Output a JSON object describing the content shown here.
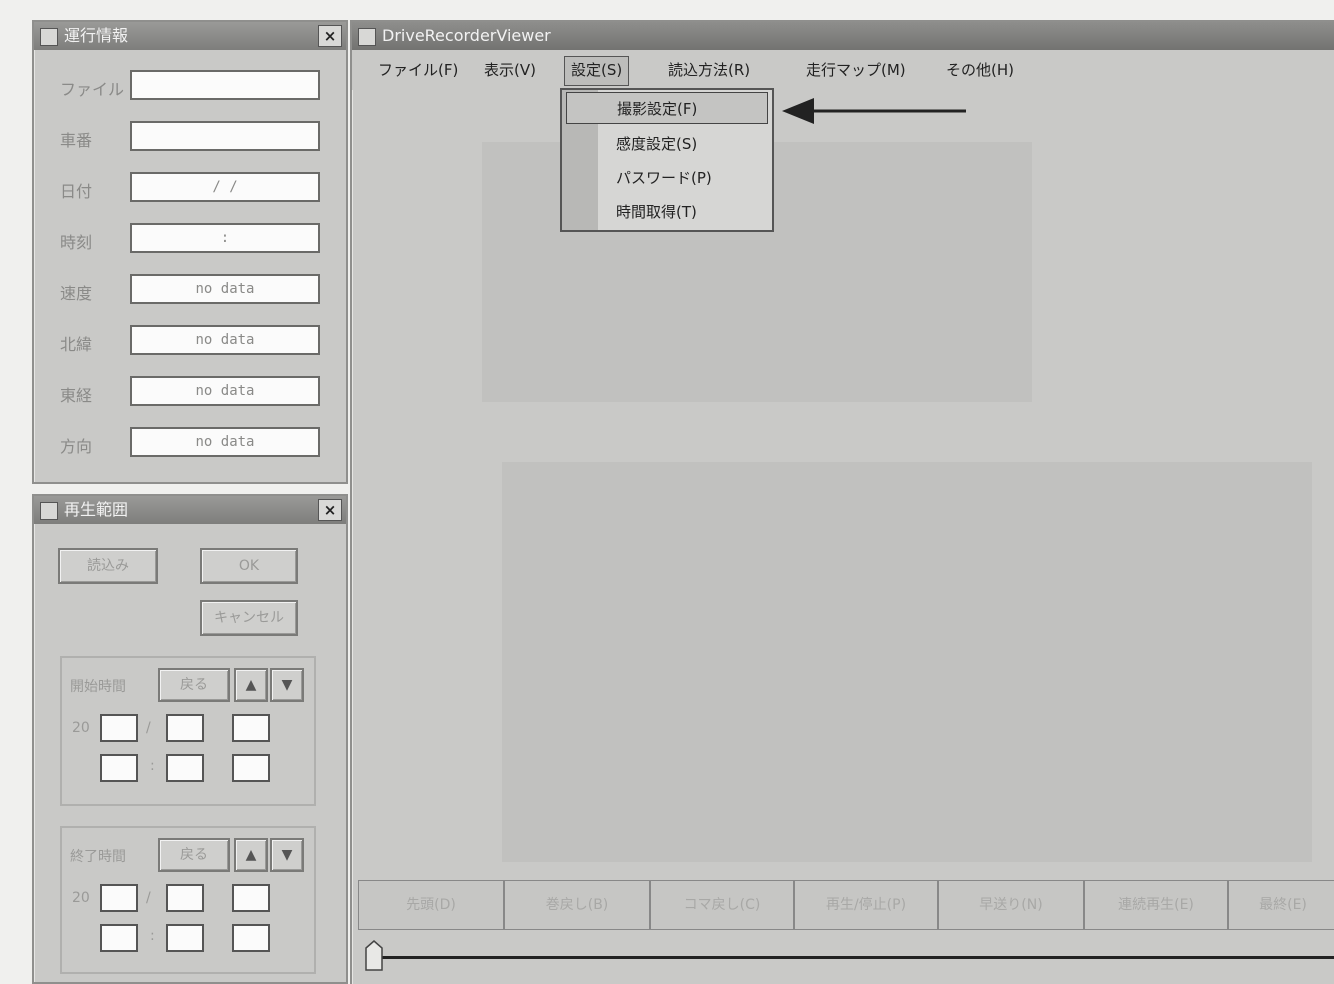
{
  "info_window": {
    "title": "運行情報",
    "close": "×",
    "rows": [
      {
        "label": "ファイル",
        "value": ""
      },
      {
        "label": "車番",
        "value": ""
      },
      {
        "label": "日付",
        "value": "/ /"
      },
      {
        "label": "時刻",
        "value": ":"
      },
      {
        "label": "速度",
        "value": "no data"
      },
      {
        "label": "北緯",
        "value": "no data"
      },
      {
        "label": "東経",
        "value": "no data"
      },
      {
        "label": "方向",
        "value": "no data"
      }
    ]
  },
  "playback_window": {
    "title": "再生範囲",
    "close": "×",
    "buttons": {
      "read": "読込み",
      "ok": "OK",
      "cancel": "キャンセル"
    },
    "start": {
      "label": "開始時間",
      "button": "戻る",
      "up": "▲",
      "down": "▼",
      "prefix": "20",
      "sep1": "/",
      "sep2": ":"
    },
    "end": {
      "label": "終了時間",
      "button": "戻る",
      "up": "▲",
      "down": "▼",
      "prefix": "20",
      "sep1": "/",
      "sep2": ":"
    }
  },
  "main_window": {
    "title": "DriveRecorderViewer",
    "menu": [
      {
        "label": "ファイル(F)"
      },
      {
        "label": "表示(V)"
      },
      {
        "label": "設定(S)"
      },
      {
        "label": "読込方法(R)"
      },
      {
        "label": "走行マップ(M)"
      },
      {
        "label": "その他(H)"
      }
    ],
    "dropdown": [
      {
        "label": "撮影設定(F)"
      },
      {
        "label": "感度設定(S)"
      },
      {
        "label": "パスワード(P)"
      },
      {
        "label": "時間取得(T)"
      }
    ],
    "toolbar": [
      {
        "label": "先頭(D)"
      },
      {
        "label": "巻戻し(B)"
      },
      {
        "label": "コマ戻し(C)"
      },
      {
        "label": "再生/停止(P)"
      },
      {
        "label": "早送り(N)"
      },
      {
        "label": "連続再生(E)"
      },
      {
        "label": "最終(E)"
      }
    ]
  }
}
